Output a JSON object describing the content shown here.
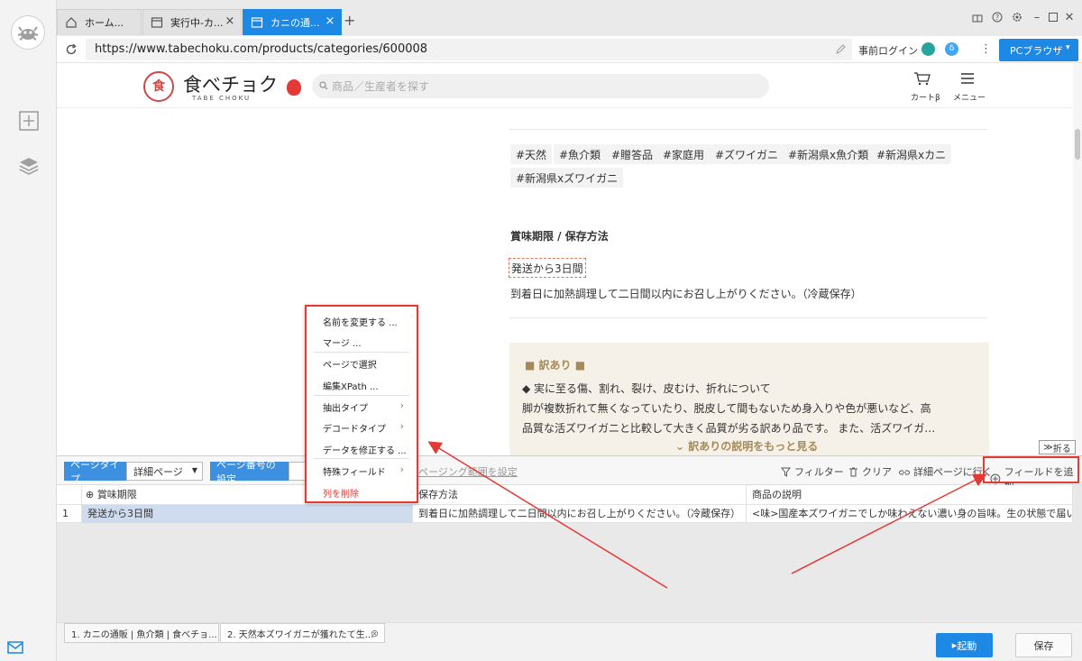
{
  "browser": {
    "tabs": [
      {
        "label": "ホーム..."
      },
      {
        "label": "実行中-カ..."
      },
      {
        "label": "カニの通..."
      }
    ],
    "url": "https://www.tabechoku.com/products/categories/600008",
    "login_label": "事前ログイン",
    "pc_browser_label": "PCブラウザ",
    "colors": {
      "accent": "#1e88e5",
      "highlight": "#e53935"
    }
  },
  "site": {
    "logo_text": "食べチョク",
    "logo_sub": "TABE CHOKU",
    "search_placeholder": "商品／生産者を探す",
    "cart_label": "カートβ",
    "menu_label": "メニュー"
  },
  "product": {
    "tags": [
      "#天然",
      "#魚介類",
      "#贈答品",
      "#家庭用",
      "#ズワイガニ",
      "#新潟県x魚介類",
      "#新潟県xカニ",
      "#新潟県xズワイガニ"
    ],
    "storage_heading": "賞味期限 / 保存方法",
    "shelf_life": "発送から3日間",
    "storage_text": "到着日に加熱調理して二日間以内にお召し上がりください。（冷蔵保存）",
    "outlet_heading": "■ 訳あり ■",
    "outlet_line1": "◆ 実に至る傷、割れ、裂け、皮むけ、折れについて",
    "outlet_line2": "脚が複数折れて無くなっていたり、脱皮して間もないため身入りや色が悪いなど、高",
    "outlet_line3": "品質な活ズワイガニと比較して大きく品質が劣る訳あり品です。 また、活ズワイガ…",
    "outlet_more": "訳ありの説明をもっと見る"
  },
  "panel": {
    "fold_label": "折る",
    "page_type_label": "ページタイプ",
    "page_type_value": "詳細ページ",
    "page_number_label": "ページ番号の設定",
    "paging_label": "ページング範囲を設定",
    "filter_label": "フィルター",
    "clear_label": "クリア",
    "goto_detail_label": "詳細ページに行く",
    "add_field_label": "フィールドを追加",
    "columns": [
      "賞味期限",
      "保存方法",
      "商品の説明"
    ],
    "rows": [
      {
        "index": "1",
        "cells": [
          "発送から3日間",
          "到着日に加熱調理して二日間以内にお召し上がりください。（冷蔵保存）",
          "<味>国産本ズワイガニでしか味わえない濃い身の旨味。生の状態で届いたらすぐ..."
        ]
      }
    ]
  },
  "context_menu": {
    "items": [
      "名前を変更する ...",
      "マージ ...",
      "ページで選択",
      "編集XPath ...",
      "抽出タイプ",
      "デコードタイプ",
      "データを修正する ...",
      "特殊フィールド",
      "列を削除"
    ]
  },
  "footer": {
    "task_tabs": [
      "1. カニの通販 | 魚介類 | 食べチョ...",
      "2. 天然本ズワイガニが獲れたて生..."
    ],
    "start_label": "起動",
    "save_label": "保存"
  }
}
